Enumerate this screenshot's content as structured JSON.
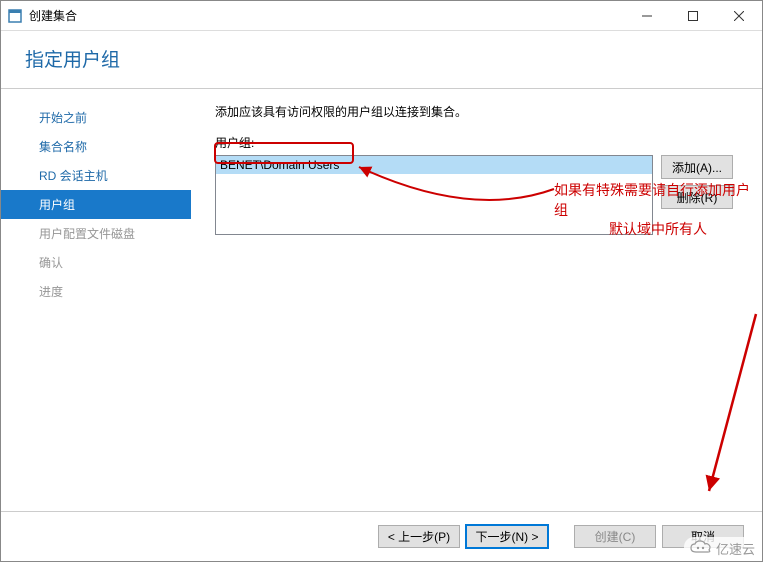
{
  "window": {
    "title": "创建集合"
  },
  "header": {
    "title": "指定用户组"
  },
  "sidebar": {
    "steps": [
      {
        "label": "开始之前"
      },
      {
        "label": "集合名称"
      },
      {
        "label": "RD 会话主机"
      },
      {
        "label": "用户组"
      },
      {
        "label": "用户配置文件磁盘"
      },
      {
        "label": "确认"
      },
      {
        "label": "进度"
      }
    ]
  },
  "main": {
    "instruction": "添加应该具有访问权限的用户组以连接到集合。",
    "listLabel": "用户组:",
    "selectedGroup": "BENET\\Domain Users",
    "addBtn": "添加(A)...",
    "removeBtn": "删除(R)"
  },
  "annotation": {
    "line1": "如果有特殊需要请自行添加用户组",
    "line2": "默认域中所有人"
  },
  "footer": {
    "prev": "< 上一步(P)",
    "next": "下一步(N) >",
    "create": "创建(C)",
    "cancel": "取消"
  },
  "watermark": "亿速云"
}
